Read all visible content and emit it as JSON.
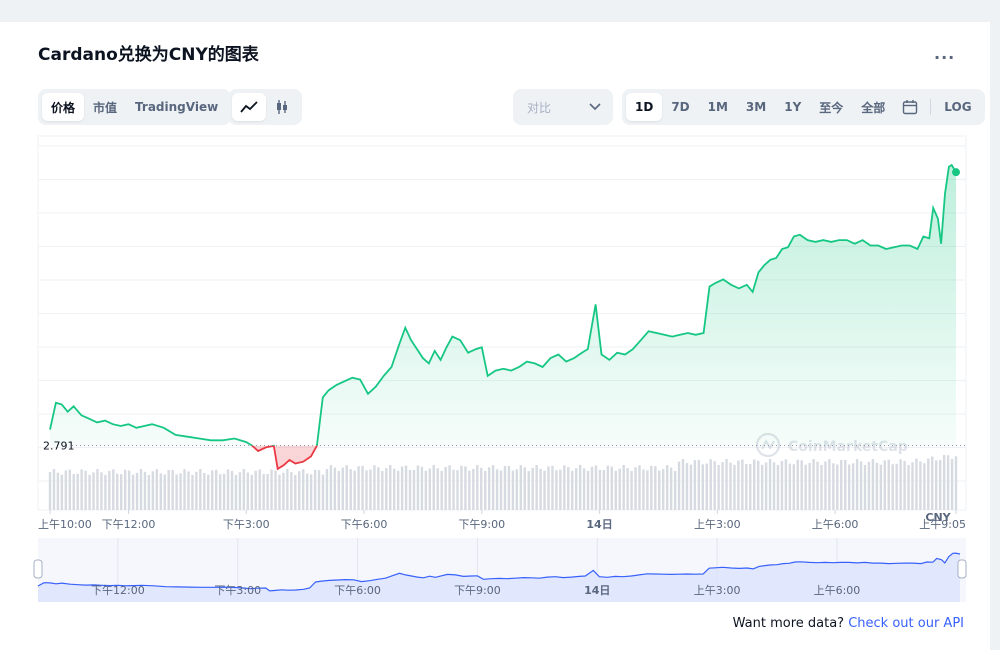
{
  "header": {
    "title": "Cardano兑换为CNY的图表",
    "more_label": "..."
  },
  "toolbar": {
    "view_tabs": [
      "价格",
      "市值",
      "TradingView"
    ],
    "active_view": 0,
    "chart_type_icons": [
      "line-chart-icon",
      "candlestick-icon"
    ],
    "compare_label": "对比",
    "ranges": [
      "1D",
      "7D",
      "1M",
      "3M",
      "1Y",
      "至今",
      "全部"
    ],
    "active_range": 0,
    "calendar_icon": "calendar-icon",
    "log_label": "LOG"
  },
  "footer": {
    "prefix": "Want more data?",
    "link": "Check out our API"
  },
  "watermark": "CoinMarketCap",
  "colors": {
    "up": "#16c784",
    "down": "#ea3943",
    "nav_line": "#3861fb",
    "nav_fill": "#dde4fb"
  },
  "chart_data": {
    "type": "line",
    "title": "",
    "currency": "CNY",
    "reference_price": "2.791",
    "reference_value": 2.791,
    "grid": true,
    "x_ticks": [
      {
        "label": "上午10:00",
        "t": 0,
        "bold": false
      },
      {
        "label": "下午12:00",
        "t": 2,
        "bold": false
      },
      {
        "label": "下午3:00",
        "t": 5,
        "bold": false
      },
      {
        "label": "下午6:00",
        "t": 8,
        "bold": false
      },
      {
        "label": "下午9:00",
        "t": 11,
        "bold": false
      },
      {
        "label": "14日",
        "t": 14,
        "bold": true
      },
      {
        "label": "上午3:00",
        "t": 17,
        "bold": false
      },
      {
        "label": "上午6:00",
        "t": 20,
        "bold": false
      },
      {
        "label": "上午9:05",
        "t": 23.08,
        "bold": false
      }
    ],
    "nav_ticks": [
      {
        "label": "下午12:00",
        "t": 2,
        "bold": false
      },
      {
        "label": "下午3:00",
        "t": 5,
        "bold": false
      },
      {
        "label": "下午6:00",
        "t": 8,
        "bold": false
      },
      {
        "label": "下午9:00",
        "t": 11,
        "bold": false
      },
      {
        "label": "14日",
        "t": 14,
        "bold": true
      },
      {
        "label": "上午3:00",
        "t": 17,
        "bold": false
      },
      {
        "label": "上午6:00",
        "t": 20,
        "bold": false
      }
    ],
    "series": [
      {
        "points": [
          [
            0.0,
            2.8
          ],
          [
            0.15,
            2.815
          ],
          [
            0.3,
            2.814
          ],
          [
            0.45,
            2.81
          ],
          [
            0.6,
            2.813
          ],
          [
            0.8,
            2.808
          ],
          [
            1.0,
            2.806
          ],
          [
            1.2,
            2.804
          ],
          [
            1.4,
            2.805
          ],
          [
            1.6,
            2.803
          ],
          [
            1.8,
            2.802
          ],
          [
            2.0,
            2.803
          ],
          [
            2.2,
            2.801
          ],
          [
            2.4,
            2.802
          ],
          [
            2.6,
            2.803
          ],
          [
            2.9,
            2.801
          ],
          [
            3.2,
            2.797
          ],
          [
            3.5,
            2.796
          ],
          [
            3.8,
            2.795
          ],
          [
            4.1,
            2.794
          ],
          [
            4.4,
            2.794
          ],
          [
            4.7,
            2.795
          ],
          [
            5.0,
            2.793
          ],
          [
            5.15,
            2.791
          ],
          [
            5.3,
            2.788
          ],
          [
            5.5,
            2.79
          ],
          [
            5.7,
            2.791
          ],
          [
            5.8,
            2.778
          ],
          [
            5.95,
            2.78
          ],
          [
            6.1,
            2.783
          ],
          [
            6.25,
            2.781
          ],
          [
            6.45,
            2.782
          ],
          [
            6.65,
            2.785
          ],
          [
            6.8,
            2.791
          ],
          [
            6.95,
            2.818
          ],
          [
            7.1,
            2.822
          ],
          [
            7.3,
            2.825
          ],
          [
            7.5,
            2.827
          ],
          [
            7.7,
            2.829
          ],
          [
            7.9,
            2.828
          ],
          [
            8.1,
            2.82
          ],
          [
            8.3,
            2.824
          ],
          [
            8.5,
            2.83
          ],
          [
            8.7,
            2.835
          ],
          [
            8.9,
            2.848
          ],
          [
            9.05,
            2.857
          ],
          [
            9.2,
            2.85
          ],
          [
            9.35,
            2.845
          ],
          [
            9.5,
            2.84
          ],
          [
            9.65,
            2.837
          ],
          [
            9.8,
            2.844
          ],
          [
            9.95,
            2.839
          ],
          [
            10.1,
            2.846
          ],
          [
            10.25,
            2.852
          ],
          [
            10.45,
            2.85
          ],
          [
            10.65,
            2.843
          ],
          [
            10.85,
            2.845
          ],
          [
            11.0,
            2.846
          ],
          [
            11.15,
            2.83
          ],
          [
            11.35,
            2.833
          ],
          [
            11.55,
            2.834
          ],
          [
            11.75,
            2.833
          ],
          [
            11.95,
            2.835
          ],
          [
            12.15,
            2.838
          ],
          [
            12.35,
            2.837
          ],
          [
            12.55,
            2.835
          ],
          [
            12.75,
            2.84
          ],
          [
            12.95,
            2.842
          ],
          [
            13.15,
            2.838
          ],
          [
            13.35,
            2.84
          ],
          [
            13.55,
            2.843
          ],
          [
            13.7,
            2.845
          ],
          [
            13.9,
            2.87
          ],
          [
            14.05,
            2.842
          ],
          [
            14.25,
            2.839
          ],
          [
            14.45,
            2.843
          ],
          [
            14.65,
            2.842
          ],
          [
            14.85,
            2.845
          ],
          [
            15.05,
            2.85
          ],
          [
            15.25,
            2.855
          ],
          [
            15.45,
            2.854
          ],
          [
            15.65,
            2.853
          ],
          [
            15.85,
            2.852
          ],
          [
            16.05,
            2.853
          ],
          [
            16.25,
            2.854
          ],
          [
            16.45,
            2.853
          ],
          [
            16.65,
            2.854
          ],
          [
            16.8,
            2.88
          ],
          [
            16.95,
            2.882
          ],
          [
            17.15,
            2.884
          ],
          [
            17.35,
            2.881
          ],
          [
            17.55,
            2.879
          ],
          [
            17.75,
            2.881
          ],
          [
            17.9,
            2.877
          ],
          [
            18.05,
            2.888
          ],
          [
            18.2,
            2.892
          ],
          [
            18.35,
            2.895
          ],
          [
            18.5,
            2.896
          ],
          [
            18.65,
            2.901
          ],
          [
            18.8,
            2.902
          ],
          [
            18.95,
            2.908
          ],
          [
            19.1,
            2.909
          ],
          [
            19.3,
            2.906
          ],
          [
            19.5,
            2.905
          ],
          [
            19.7,
            2.906
          ],
          [
            19.9,
            2.905
          ],
          [
            20.1,
            2.906
          ],
          [
            20.3,
            2.906
          ],
          [
            20.5,
            2.904
          ],
          [
            20.7,
            2.906
          ],
          [
            20.9,
            2.903
          ],
          [
            21.1,
            2.903
          ],
          [
            21.3,
            2.901
          ],
          [
            21.5,
            2.902
          ],
          [
            21.7,
            2.903
          ],
          [
            21.9,
            2.903
          ],
          [
            22.1,
            2.901
          ],
          [
            22.25,
            2.908
          ],
          [
            22.4,
            2.907
          ],
          [
            22.5,
            2.924
          ],
          [
            22.62,
            2.918
          ],
          [
            22.7,
            2.904
          ],
          [
            22.8,
            2.932
          ],
          [
            22.9,
            2.947
          ],
          [
            22.97,
            2.948
          ],
          [
            23.08,
            2.944
          ]
        ]
      }
    ],
    "ylim": [
      2.755,
      2.962
    ],
    "xlim": [
      0,
      23.08
    ]
  }
}
